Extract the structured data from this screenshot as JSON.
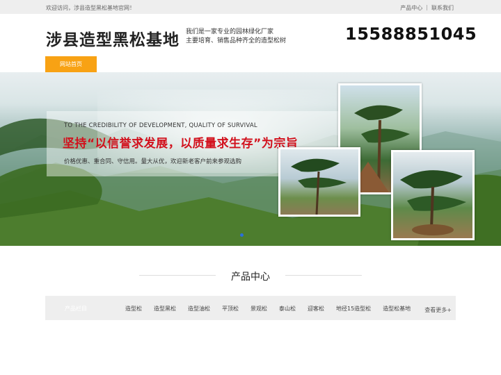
{
  "topbar": {
    "welcome": "欢迎访问，涉县造型黑松基地官网！",
    "links": [
      "产品中心",
      "联系我们"
    ],
    "separator": "|"
  },
  "header": {
    "logo": "涉县造型黑松基地",
    "tagline_line1": "我们是一家专业的园林绿化厂家",
    "tagline_line2": "主要培育、销售品种齐全的造型松树",
    "phone": "15588851045"
  },
  "nav": {
    "home": "网站首页"
  },
  "banner": {
    "english": "TO THE CREDIBILITY OF DEVELOPMENT, QUALITY OF SURVIVAL",
    "slogan": "坚持“以信誉求发展，以质量求生存”为宗旨",
    "subtitle": "价格优惠、重合同、守信用。量大从优，欢迎新老客户前来参观选购",
    "slide_count": 3,
    "active_slide": 1
  },
  "products": {
    "section_title": "产品中心",
    "category_title": "产品栏目",
    "categories": [
      "造型松",
      "造型黑松",
      "造型油松",
      "平顶松",
      "景观松",
      "泰山松",
      "迎客松",
      "地径15造型松",
      "造型松基地"
    ],
    "more": "查看更多+"
  },
  "colors": {
    "accent": "#f8a214",
    "slogan_red": "#d2101c",
    "active_dot": "#2a6fdb"
  }
}
